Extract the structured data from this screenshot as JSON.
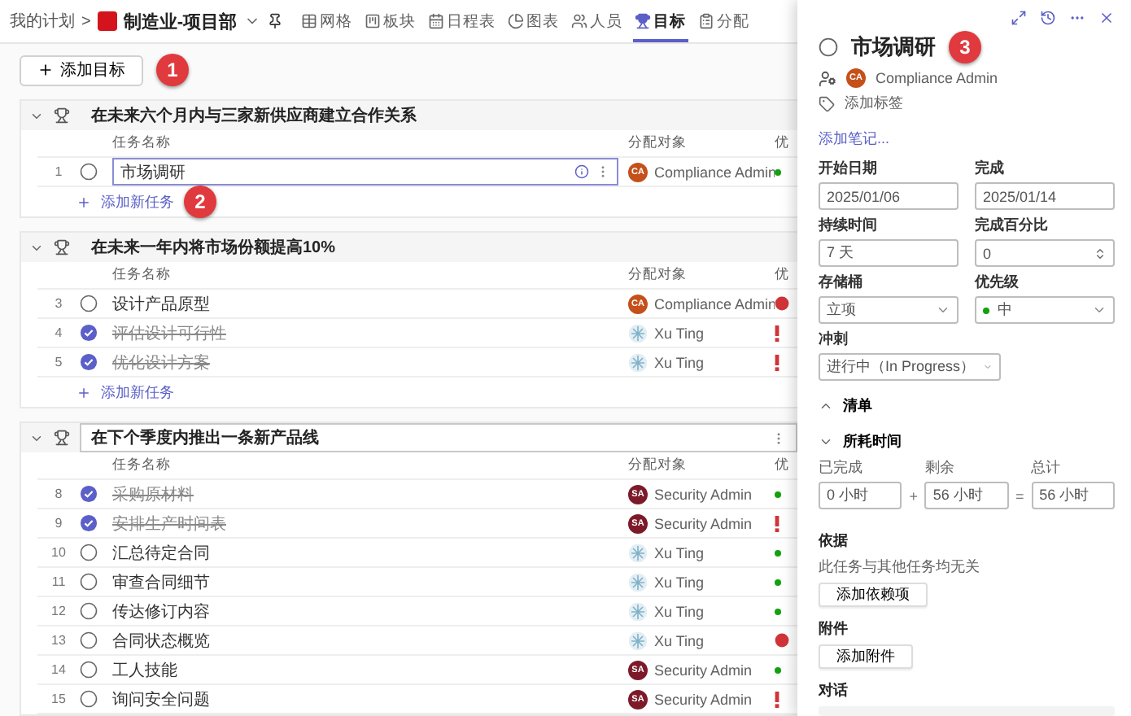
{
  "breadcrumb": {
    "root": "我的计划",
    "separator": ">",
    "plan": "制造业-项目部"
  },
  "tabs": [
    {
      "label": "网格",
      "selected": false
    },
    {
      "label": "板块",
      "selected": false
    },
    {
      "label": "日程表",
      "selected": false
    },
    {
      "label": "图表",
      "selected": false
    },
    {
      "label": "人员",
      "selected": false
    },
    {
      "label": "目标",
      "selected": true
    },
    {
      "label": "分配",
      "selected": false
    }
  ],
  "add_goal": {
    "label": "添加目标",
    "badge": "1"
  },
  "goals": [
    {
      "title": "在未来六个月内与三家新供应商建立合作关系",
      "expanded": true,
      "hovered": false,
      "columns": [
        "任务名称",
        "分配对象",
        "优"
      ],
      "add_task": "添加新任务",
      "add_badge": "2",
      "tasks": [
        {
          "number": "1",
          "name": "市场调研",
          "completed": false,
          "editing": true,
          "assignee": {
            "kind": "initials",
            "initials": "CA",
            "name": "Compliance Admin",
            "color": "#c4501a"
          },
          "priority": {
            "kind": "low"
          }
        }
      ]
    },
    {
      "title": "在未来一年内将市场份额提高10%",
      "expanded": true,
      "hovered": false,
      "columns": [
        "任务名称",
        "分配对象",
        "优"
      ],
      "add_task": "添加新任务",
      "tasks": [
        {
          "number": "3",
          "name": "设计产品原型",
          "completed": false,
          "editing": false,
          "assignee": {
            "kind": "initials",
            "initials": "CA",
            "name": "Compliance Admin",
            "color": "#c4501a"
          },
          "priority": {
            "kind": "urgent"
          }
        },
        {
          "number": "4",
          "name": "评估设计可行性",
          "completed": true,
          "editing": false,
          "assignee": {
            "kind": "photo",
            "name": "Xu Ting"
          },
          "priority": {
            "kind": "important"
          }
        },
        {
          "number": "5",
          "name": "优化设计方案",
          "completed": true,
          "editing": false,
          "assignee": {
            "kind": "photo",
            "name": "Xu Ting"
          },
          "priority": {
            "kind": "important"
          }
        }
      ]
    },
    {
      "title": "在下个季度内推出一条新产品线",
      "expanded": true,
      "hovered": true,
      "columns": [
        "任务名称",
        "分配对象",
        "优"
      ],
      "tasks": [
        {
          "number": "8",
          "name": "采购原材料",
          "completed": true,
          "editing": false,
          "assignee": {
            "kind": "initials",
            "initials": "SA",
            "name": "Security Admin",
            "color": "#7d1a2a"
          },
          "priority": {
            "kind": "low"
          }
        },
        {
          "number": "9",
          "name": "安排生产时间表",
          "completed": true,
          "editing": false,
          "assignee": {
            "kind": "initials",
            "initials": "SA",
            "name": "Security Admin",
            "color": "#7d1a2a"
          },
          "priority": {
            "kind": "important"
          }
        },
        {
          "number": "10",
          "name": "汇总待定合同",
          "completed": false,
          "editing": false,
          "assignee": {
            "kind": "photo",
            "name": "Xu Ting"
          },
          "priority": {
            "kind": "low"
          }
        },
        {
          "number": "11",
          "name": "审查合同细节",
          "completed": false,
          "editing": false,
          "assignee": {
            "kind": "photo",
            "name": "Xu Ting"
          },
          "priority": {
            "kind": "low"
          }
        },
        {
          "number": "12",
          "name": "传达修订内容",
          "completed": false,
          "editing": false,
          "assignee": {
            "kind": "photo",
            "name": "Xu Ting"
          },
          "priority": {
            "kind": "low"
          }
        },
        {
          "number": "13",
          "name": "合同状态概览",
          "completed": false,
          "editing": false,
          "assignee": {
            "kind": "photo",
            "name": "Xu Ting"
          },
          "priority": {
            "kind": "urgent"
          }
        },
        {
          "number": "14",
          "name": "工人技能",
          "completed": false,
          "editing": false,
          "assignee": {
            "kind": "initials",
            "initials": "SA",
            "name": "Security Admin",
            "color": "#7d1a2a"
          },
          "priority": {
            "kind": "low"
          }
        },
        {
          "number": "15",
          "name": "询问安全问题",
          "completed": false,
          "editing": false,
          "assignee": {
            "kind": "initials",
            "initials": "SA",
            "name": "Security Admin",
            "color": "#7d1a2a"
          },
          "priority": {
            "kind": "important"
          }
        }
      ]
    }
  ],
  "details": {
    "title": "市场调研",
    "completed": false,
    "badge": "3",
    "assignee": {
      "initials": "CA",
      "name": "Compliance Admin",
      "color": "#c4501a"
    },
    "add_label": "添加标签",
    "add_note": "添加笔记...",
    "fields": [
      {
        "kind": "text",
        "label": "开始日期",
        "value": "2025/01/06"
      },
      {
        "kind": "text",
        "label": "完成",
        "value": "2025/01/14"
      },
      {
        "kind": "text",
        "label": "持续时间",
        "value": "7 天"
      },
      {
        "kind": "spinner",
        "label": "完成百分比",
        "value": "0"
      },
      {
        "kind": "select",
        "label": "存储桶",
        "value": "立项"
      },
      {
        "kind": "select",
        "label": "优先级",
        "value": "中",
        "priority": {
          "kind": "low"
        }
      },
      {
        "kind": "select",
        "label": "冲刺",
        "value": "进行中（In Progress）"
      }
    ],
    "sections": [
      {
        "title": "清单",
        "expanded": false
      },
      {
        "title": "所耗时间",
        "expanded": true
      }
    ],
    "time": {
      "completed": {
        "label": "已完成",
        "value": "0 小时"
      },
      "plus": "+",
      "remaining": {
        "label": "剩余",
        "value": "56 小时"
      },
      "equals": "=",
      "total": {
        "label": "总计",
        "value": "56 小时"
      }
    },
    "dependencies": {
      "title": "依据",
      "text": "此任务与其他任务均无关",
      "button": "添加依赖项"
    },
    "attachments": {
      "title": "附件",
      "button": "添加附件"
    },
    "conversation": {
      "title": "对话"
    }
  }
}
